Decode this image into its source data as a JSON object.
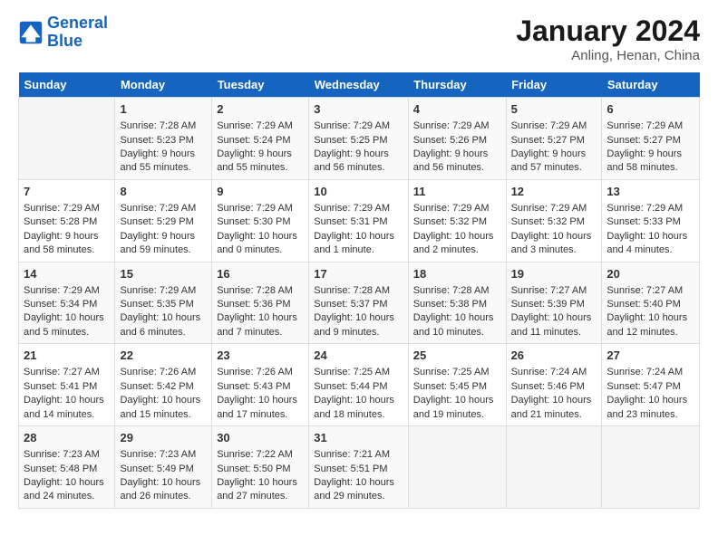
{
  "header": {
    "logo_line1": "General",
    "logo_line2": "Blue",
    "title": "January 2024",
    "subtitle": "Anling, Henan, China"
  },
  "days_of_week": [
    "Sunday",
    "Monday",
    "Tuesday",
    "Wednesday",
    "Thursday",
    "Friday",
    "Saturday"
  ],
  "weeks": [
    [
      {
        "day": "",
        "sunrise": "",
        "sunset": "",
        "daylight": ""
      },
      {
        "day": "1",
        "sunrise": "Sunrise: 7:28 AM",
        "sunset": "Sunset: 5:23 PM",
        "daylight": "Daylight: 9 hours and 55 minutes."
      },
      {
        "day": "2",
        "sunrise": "Sunrise: 7:29 AM",
        "sunset": "Sunset: 5:24 PM",
        "daylight": "Daylight: 9 hours and 55 minutes."
      },
      {
        "day": "3",
        "sunrise": "Sunrise: 7:29 AM",
        "sunset": "Sunset: 5:25 PM",
        "daylight": "Daylight: 9 hours and 56 minutes."
      },
      {
        "day": "4",
        "sunrise": "Sunrise: 7:29 AM",
        "sunset": "Sunset: 5:26 PM",
        "daylight": "Daylight: 9 hours and 56 minutes."
      },
      {
        "day": "5",
        "sunrise": "Sunrise: 7:29 AM",
        "sunset": "Sunset: 5:27 PM",
        "daylight": "Daylight: 9 hours and 57 minutes."
      },
      {
        "day": "6",
        "sunrise": "Sunrise: 7:29 AM",
        "sunset": "Sunset: 5:27 PM",
        "daylight": "Daylight: 9 hours and 58 minutes."
      }
    ],
    [
      {
        "day": "7",
        "sunrise": "Sunrise: 7:29 AM",
        "sunset": "Sunset: 5:28 PM",
        "daylight": "Daylight: 9 hours and 58 minutes."
      },
      {
        "day": "8",
        "sunrise": "Sunrise: 7:29 AM",
        "sunset": "Sunset: 5:29 PM",
        "daylight": "Daylight: 9 hours and 59 minutes."
      },
      {
        "day": "9",
        "sunrise": "Sunrise: 7:29 AM",
        "sunset": "Sunset: 5:30 PM",
        "daylight": "Daylight: 10 hours and 0 minutes."
      },
      {
        "day": "10",
        "sunrise": "Sunrise: 7:29 AM",
        "sunset": "Sunset: 5:31 PM",
        "daylight": "Daylight: 10 hours and 1 minute."
      },
      {
        "day": "11",
        "sunrise": "Sunrise: 7:29 AM",
        "sunset": "Sunset: 5:32 PM",
        "daylight": "Daylight: 10 hours and 2 minutes."
      },
      {
        "day": "12",
        "sunrise": "Sunrise: 7:29 AM",
        "sunset": "Sunset: 5:32 PM",
        "daylight": "Daylight: 10 hours and 3 minutes."
      },
      {
        "day": "13",
        "sunrise": "Sunrise: 7:29 AM",
        "sunset": "Sunset: 5:33 PM",
        "daylight": "Daylight: 10 hours and 4 minutes."
      }
    ],
    [
      {
        "day": "14",
        "sunrise": "Sunrise: 7:29 AM",
        "sunset": "Sunset: 5:34 PM",
        "daylight": "Daylight: 10 hours and 5 minutes."
      },
      {
        "day": "15",
        "sunrise": "Sunrise: 7:29 AM",
        "sunset": "Sunset: 5:35 PM",
        "daylight": "Daylight: 10 hours and 6 minutes."
      },
      {
        "day": "16",
        "sunrise": "Sunrise: 7:28 AM",
        "sunset": "Sunset: 5:36 PM",
        "daylight": "Daylight: 10 hours and 7 minutes."
      },
      {
        "day": "17",
        "sunrise": "Sunrise: 7:28 AM",
        "sunset": "Sunset: 5:37 PM",
        "daylight": "Daylight: 10 hours and 9 minutes."
      },
      {
        "day": "18",
        "sunrise": "Sunrise: 7:28 AM",
        "sunset": "Sunset: 5:38 PM",
        "daylight": "Daylight: 10 hours and 10 minutes."
      },
      {
        "day": "19",
        "sunrise": "Sunrise: 7:27 AM",
        "sunset": "Sunset: 5:39 PM",
        "daylight": "Daylight: 10 hours and 11 minutes."
      },
      {
        "day": "20",
        "sunrise": "Sunrise: 7:27 AM",
        "sunset": "Sunset: 5:40 PM",
        "daylight": "Daylight: 10 hours and 12 minutes."
      }
    ],
    [
      {
        "day": "21",
        "sunrise": "Sunrise: 7:27 AM",
        "sunset": "Sunset: 5:41 PM",
        "daylight": "Daylight: 10 hours and 14 minutes."
      },
      {
        "day": "22",
        "sunrise": "Sunrise: 7:26 AM",
        "sunset": "Sunset: 5:42 PM",
        "daylight": "Daylight: 10 hours and 15 minutes."
      },
      {
        "day": "23",
        "sunrise": "Sunrise: 7:26 AM",
        "sunset": "Sunset: 5:43 PM",
        "daylight": "Daylight: 10 hours and 17 minutes."
      },
      {
        "day": "24",
        "sunrise": "Sunrise: 7:25 AM",
        "sunset": "Sunset: 5:44 PM",
        "daylight": "Daylight: 10 hours and 18 minutes."
      },
      {
        "day": "25",
        "sunrise": "Sunrise: 7:25 AM",
        "sunset": "Sunset: 5:45 PM",
        "daylight": "Daylight: 10 hours and 19 minutes."
      },
      {
        "day": "26",
        "sunrise": "Sunrise: 7:24 AM",
        "sunset": "Sunset: 5:46 PM",
        "daylight": "Daylight: 10 hours and 21 minutes."
      },
      {
        "day": "27",
        "sunrise": "Sunrise: 7:24 AM",
        "sunset": "Sunset: 5:47 PM",
        "daylight": "Daylight: 10 hours and 23 minutes."
      }
    ],
    [
      {
        "day": "28",
        "sunrise": "Sunrise: 7:23 AM",
        "sunset": "Sunset: 5:48 PM",
        "daylight": "Daylight: 10 hours and 24 minutes."
      },
      {
        "day": "29",
        "sunrise": "Sunrise: 7:23 AM",
        "sunset": "Sunset: 5:49 PM",
        "daylight": "Daylight: 10 hours and 26 minutes."
      },
      {
        "day": "30",
        "sunrise": "Sunrise: 7:22 AM",
        "sunset": "Sunset: 5:50 PM",
        "daylight": "Daylight: 10 hours and 27 minutes."
      },
      {
        "day": "31",
        "sunrise": "Sunrise: 7:21 AM",
        "sunset": "Sunset: 5:51 PM",
        "daylight": "Daylight: 10 hours and 29 minutes."
      },
      {
        "day": "",
        "sunrise": "",
        "sunset": "",
        "daylight": ""
      },
      {
        "day": "",
        "sunrise": "",
        "sunset": "",
        "daylight": ""
      },
      {
        "day": "",
        "sunrise": "",
        "sunset": "",
        "daylight": ""
      }
    ]
  ]
}
